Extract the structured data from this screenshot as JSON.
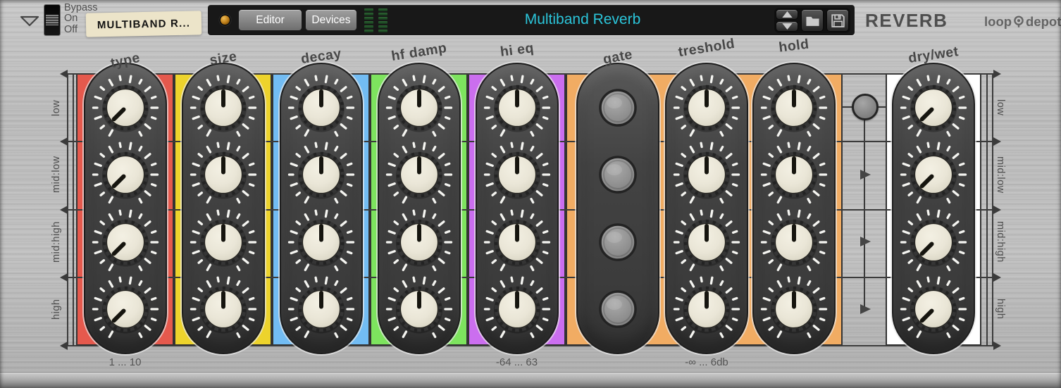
{
  "device": {
    "name_label": "REVERB",
    "brand": {
      "prefix": "loop",
      "suffix": "depot"
    }
  },
  "header": {
    "bypass_switch": {
      "options": [
        "Bypass",
        "On",
        "Off"
      ],
      "selected": "On"
    },
    "preset_name": "MULTIBAND R...",
    "view_buttons": [
      {
        "label": "Editor"
      },
      {
        "label": "Devices"
      }
    ],
    "plugin_title": "Multiband Reverb",
    "meter": {
      "columns": 2,
      "segments": 6
    },
    "colors": {
      "plugin_title": "#2bc5da",
      "title_bar_bg": "#181818",
      "panel_metal": "#bcbcbc",
      "label_text": "#474747"
    }
  },
  "bands": [
    "low",
    "mid:low",
    "mid:high",
    "high"
  ],
  "columns": [
    {
      "label": "type",
      "color": "#e5594d",
      "control": "knob",
      "knob_angle_deg": -135,
      "range_label": "1 ... 10"
    },
    {
      "label": "size",
      "color": "#edd32c",
      "control": "knob",
      "knob_angle_deg": 0
    },
    {
      "label": "decay",
      "color": "#72bcf3",
      "control": "knob",
      "knob_angle_deg": 0
    },
    {
      "label": "hf damp",
      "color": "#7de35e",
      "control": "knob",
      "knob_angle_deg": 0
    },
    {
      "label": "hi eq",
      "color": "#cb6eef",
      "control": "knob",
      "knob_angle_deg": 0,
      "range_label": "-64 ... 63"
    },
    {
      "label": "gate",
      "color": "#f1ac63",
      "control": "button"
    },
    {
      "label": "treshold",
      "color": "#f1ac63",
      "control": "knob",
      "knob_angle_deg": 0,
      "range_label": "-∞ ... 6db"
    },
    {
      "label": "hold",
      "color": "#f1ac63",
      "control": "knob",
      "knob_angle_deg": 0
    },
    {
      "label": "dry/wet",
      "color": "#ffffff",
      "control": "knob",
      "knob_angle_deg": -135
    }
  ]
}
